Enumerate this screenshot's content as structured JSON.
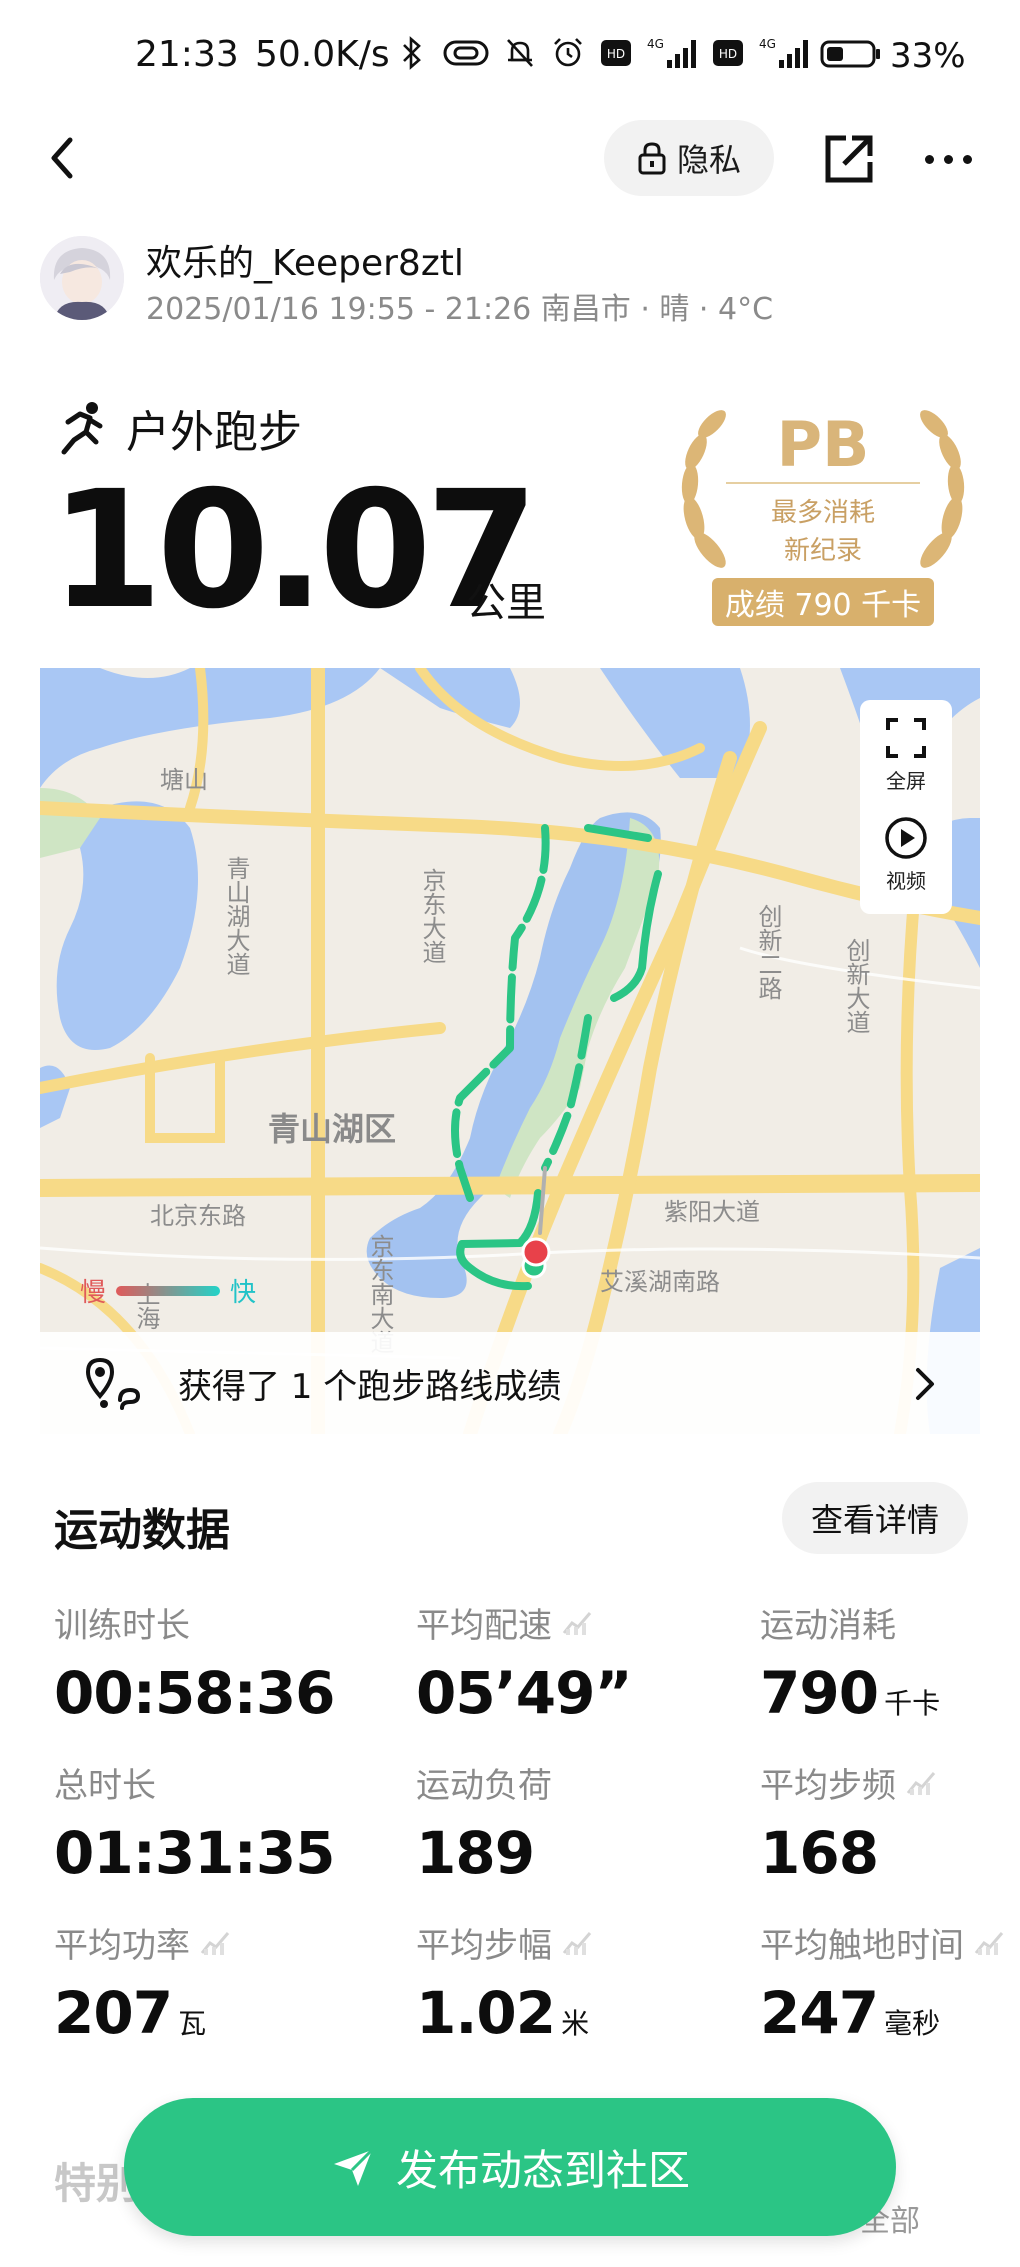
{
  "status_bar": {
    "time": "21:33",
    "speed": "50.0K/s",
    "battery": "33%",
    "icons": [
      "bluetooth-icon",
      "vpn-key-icon",
      "mute-bell-icon",
      "alarm-icon",
      "hd-icon",
      "signal-4g-icon",
      "hd-icon",
      "signal-4g-icon",
      "battery-icon"
    ]
  },
  "header": {
    "privacy_label": "隐私"
  },
  "user": {
    "name": "欢乐的_Keeper8ztl",
    "meta": "2025/01/16 19:55 - 21:26 南昌市 · 晴 · 4°C"
  },
  "activity": {
    "type": "户外跑步",
    "distance": "10.07",
    "unit": "公里"
  },
  "pb": {
    "title": "PB",
    "line1": "最多消耗",
    "line2": "新纪录",
    "score": "成绩 790 千卡"
  },
  "map": {
    "labels": {
      "tangshan": "塘山",
      "qingshanhu_dadao": "青山湖大道",
      "jingdong_dadao": "京东大道",
      "chuangxin_erlu": "创新二路",
      "chuangxin_dadao": "创新大道",
      "qingshanhu_qu": "青山湖区",
      "beijing_donglu": "北京东路",
      "ziyang_dadao": "紫阳大道",
      "aixihu_nanlu": "艾溪湖南路",
      "jingdong_nandadao": "京东南大道",
      "shanghai": "上海"
    },
    "fullscreen_label": "全屏",
    "video_label": "视频",
    "legend_slow": "慢",
    "legend_fast": "快",
    "route_banner": "获得了 1 个跑步路线成绩"
  },
  "stats": {
    "title": "运动数据",
    "details_button": "查看详情",
    "items": [
      {
        "label": "训练时长",
        "value": "00:58:36",
        "unit": "",
        "trend": false
      },
      {
        "label": "平均配速",
        "value": "05’49”",
        "unit": "",
        "trend": true
      },
      {
        "label": "运动消耗",
        "value": "790",
        "unit": "千卡",
        "trend": false
      },
      {
        "label": "总时长",
        "value": "01:31:35",
        "unit": "",
        "trend": false
      },
      {
        "label": "运动负荷",
        "value": "189",
        "unit": "",
        "trend": false
      },
      {
        "label": "平均步频",
        "value": "168",
        "unit": "",
        "trend": true
      },
      {
        "label": "平均功率",
        "value": "207",
        "unit": "瓦",
        "trend": true
      },
      {
        "label": "平均步幅",
        "value": "1.02",
        "unit": "米",
        "trend": true
      },
      {
        "label": "平均触地时间",
        "value": "247",
        "unit": "毫秒",
        "trend": true
      }
    ]
  },
  "bottom": {
    "section_title": "特别",
    "all_label": "全部",
    "publish_label": "发布动态到社区"
  },
  "colors": {
    "accent": "#2bc585",
    "route": "#2bc585",
    "pb_gold": "#d8b06c",
    "water": "#a3c4f3",
    "road": "#f8dc8e"
  }
}
